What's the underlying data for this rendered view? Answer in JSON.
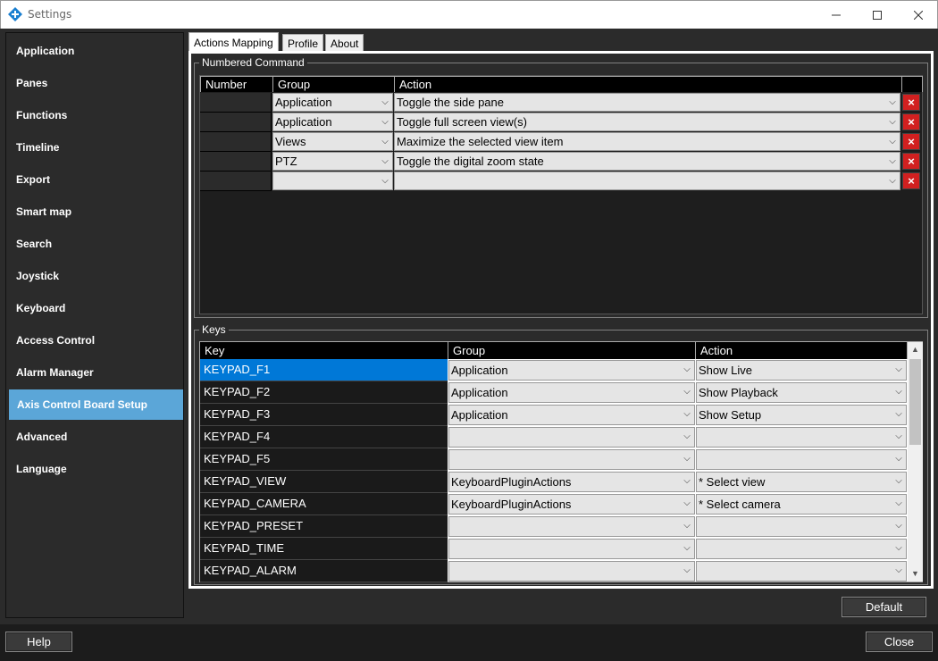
{
  "window": {
    "title": "Settings"
  },
  "sidebar": {
    "items": [
      {
        "label": "Application"
      },
      {
        "label": "Panes"
      },
      {
        "label": "Functions"
      },
      {
        "label": "Timeline"
      },
      {
        "label": "Export"
      },
      {
        "label": "Smart map"
      },
      {
        "label": "Search"
      },
      {
        "label": "Joystick"
      },
      {
        "label": "Keyboard"
      },
      {
        "label": "Access Control"
      },
      {
        "label": "Alarm Manager"
      },
      {
        "label": "Axis Control Board Setup"
      },
      {
        "label": "Advanced"
      },
      {
        "label": "Language"
      }
    ],
    "active_index": 11
  },
  "tabs": [
    "Actions Mapping",
    "Profile",
    "About"
  ],
  "numbered": {
    "title": "Numbered Command",
    "headers": [
      "Number",
      "Group",
      "Action"
    ],
    "rows": [
      {
        "number": "",
        "group": "Application",
        "action": "Toggle the side pane"
      },
      {
        "number": "",
        "group": "Application",
        "action": "Toggle full screen view(s)"
      },
      {
        "number": "",
        "group": "Views",
        "action": "Maximize the selected view item"
      },
      {
        "number": "",
        "group": "PTZ",
        "action": "Toggle the digital zoom state"
      },
      {
        "number": "",
        "group": "",
        "action": ""
      }
    ]
  },
  "keys": {
    "title": "Keys",
    "headers": [
      "Key",
      "Group",
      "Action"
    ],
    "rows": [
      {
        "key": "KEYPAD_F1",
        "group": "Application",
        "action": "Show Live"
      },
      {
        "key": "KEYPAD_F2",
        "group": "Application",
        "action": "Show Playback"
      },
      {
        "key": "KEYPAD_F3",
        "group": "Application",
        "action": "Show Setup"
      },
      {
        "key": "KEYPAD_F4",
        "group": "",
        "action": ""
      },
      {
        "key": "KEYPAD_F5",
        "group": "",
        "action": ""
      },
      {
        "key": "KEYPAD_VIEW",
        "group": "KeyboardPluginActions",
        "action": "* Select view"
      },
      {
        "key": "KEYPAD_CAMERA",
        "group": "KeyboardPluginActions",
        "action": "* Select camera"
      },
      {
        "key": "KEYPAD_PRESET",
        "group": "",
        "action": ""
      },
      {
        "key": "KEYPAD_TIME",
        "group": "",
        "action": ""
      },
      {
        "key": "KEYPAD_ALARM",
        "group": "",
        "action": ""
      }
    ],
    "selected_index": 0
  },
  "buttons": {
    "default": "Default",
    "help": "Help",
    "close": "Close"
  },
  "colors": {
    "accent": "#5ba6d8",
    "selection": "#0078d7",
    "delete": "#d12020"
  },
  "icons": {
    "delete": "×",
    "dropdown": "⌵"
  }
}
